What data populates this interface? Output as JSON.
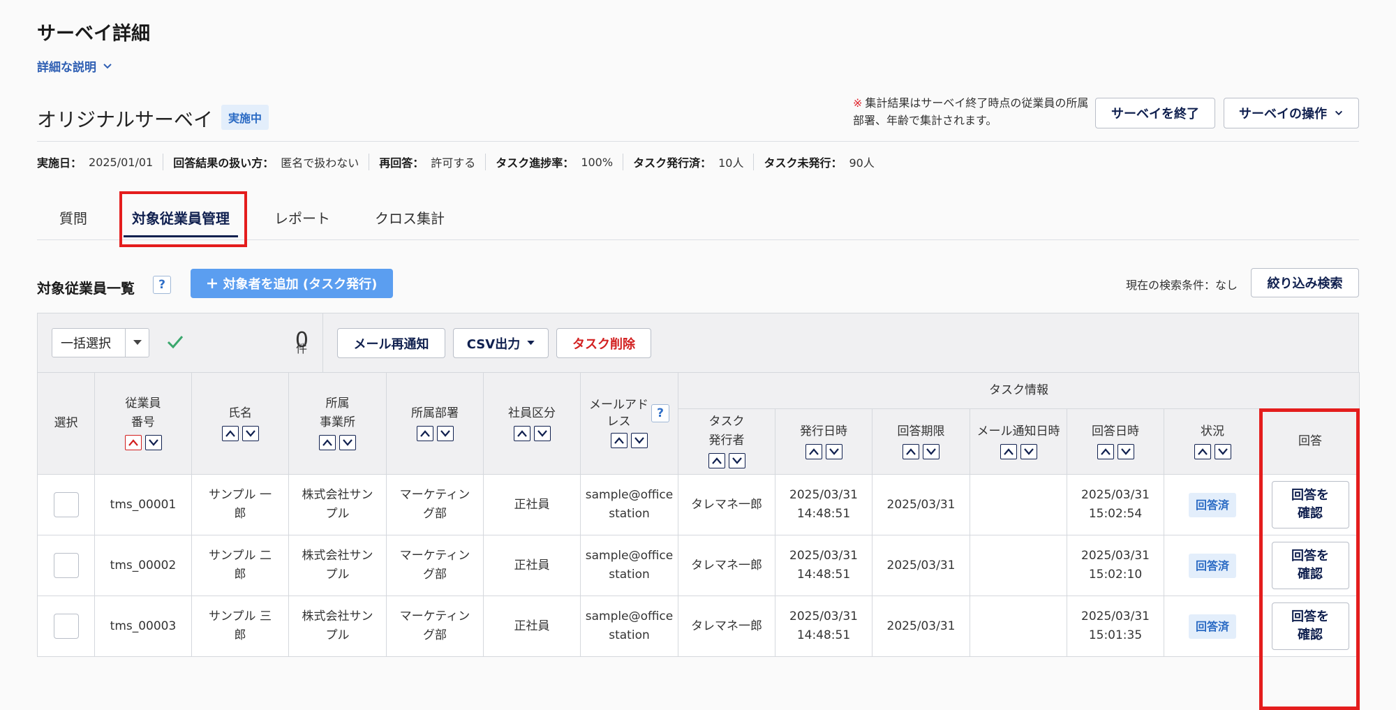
{
  "page": {
    "title": "サーベイ詳細",
    "detail_toggle": "詳細な説明"
  },
  "survey": {
    "name": "オリジナルサーベイ",
    "status": "実施中"
  },
  "notice": {
    "mark": "※",
    "text": "集計結果はサーベイ終了時点の従業員の所属部署、年齢で集計されます。"
  },
  "header_buttons": {
    "end": "サーベイを終了",
    "ops": "サーベイの操作"
  },
  "meta": [
    {
      "key": "実施日：",
      "value": "2025/01/01"
    },
    {
      "key": "回答結果の扱い方：",
      "value": "匿名で扱わない"
    },
    {
      "key": "再回答：",
      "value": "許可する"
    },
    {
      "key": "タスク進捗率：",
      "value": "100%"
    },
    {
      "key": "タスク発行済：",
      "value": "10人"
    },
    {
      "key": "タスク未発行：",
      "value": "90人"
    }
  ],
  "tabs": [
    "質問",
    "対象従業員管理",
    "レポート",
    "クロス集計"
  ],
  "list": {
    "title": "対象従業員一覧",
    "help": "?",
    "add_label": "対象者を追加 (タスク発行)",
    "search_cond": "現在の検索条件：なし",
    "filter_label": "絞り込み検索"
  },
  "toolbar": {
    "bulk_select": "一括選択",
    "count": "0",
    "count_unit": "件",
    "mail_label": "メール再通知",
    "csv_label": "CSV出力",
    "delete_label": "タスク削除"
  },
  "table": {
    "headers": {
      "select": "選択",
      "emp_no": "従業員\n番号",
      "name": "氏名",
      "office": "所属\n事業所",
      "dept": "所属部署",
      "type": "社員区分",
      "email": "メールアド\nレス",
      "task_info": "タスク情報",
      "issuer": "タスク\n発行者",
      "issued_at": "発行日時",
      "deadline": "回答期限",
      "mail_at": "メール通知日時",
      "answered_at": "回答日時",
      "status": "状況",
      "answer": "回答"
    },
    "rows": [
      {
        "emp_no": "tms_00001",
        "name": "サンプル 一\n郎",
        "office": "株式会社サン\nプル",
        "dept": "マーケティン\nグ部",
        "type": "正社員",
        "email": "sample@office\nstation",
        "issuer": "タレマネ一郎",
        "issued_at": "2025/03/31\n14:48:51",
        "deadline": "2025/03/31",
        "mail_at": "",
        "answered_at": "2025/03/31\n15:02:54",
        "status": "回答済",
        "answer": "回答を\n確認"
      },
      {
        "emp_no": "tms_00002",
        "name": "サンプル 二\n郎",
        "office": "株式会社サン\nプル",
        "dept": "マーケティン\nグ部",
        "type": "正社員",
        "email": "sample@office\nstation",
        "issuer": "タレマネ一郎",
        "issued_at": "2025/03/31\n14:48:51",
        "deadline": "2025/03/31",
        "mail_at": "",
        "answered_at": "2025/03/31\n15:02:10",
        "status": "回答済",
        "answer": "回答を\n確認"
      },
      {
        "emp_no": "tms_00003",
        "name": "サンプル 三\n郎",
        "office": "株式会社サン\nプル",
        "dept": "マーケティン\nグ部",
        "type": "正社員",
        "email": "sample@office\nstation",
        "issuer": "タレマネ一郎",
        "issued_at": "2025/03/31\n14:48:51",
        "deadline": "2025/03/31",
        "mail_at": "",
        "answered_at": "2025/03/31\n15:01:35",
        "status": "回答済",
        "answer": "回答を\n確認"
      }
    ]
  },
  "colors": {
    "accent": "#10204f",
    "primary": "#5b9ef0",
    "danger": "#d21f1f",
    "highlight": "#e41d1d",
    "badge_bg": "#e3eefb"
  },
  "icons": [
    "chevron-down-icon",
    "plus-icon",
    "check-icon",
    "sort-up-icon",
    "sort-down-icon",
    "help-icon"
  ]
}
